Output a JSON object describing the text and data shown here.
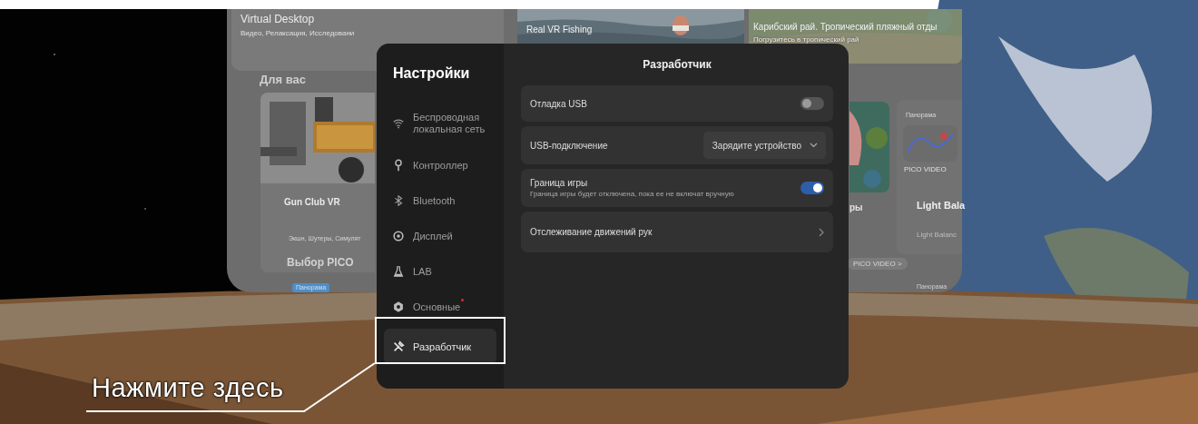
{
  "store": {
    "banners": [
      {
        "title": "Virtual Desktop",
        "subtitle": "Видео, Релаксация, Исследовани"
      },
      {
        "title": "Real VR Fishing"
      },
      {
        "title": "Карибский рай. Тропический пляжный отды",
        "subtitle": "Погрузитесь в тропический рай"
      }
    ],
    "section_for_you": "Для вас",
    "game_card": {
      "title": "Gun Club VR",
      "tags": "Экшн, Шутеры, Симулят"
    },
    "section_pico": "Выбор PICO",
    "tag_bottom_left": "Панорама",
    "coral_card_title": "ры",
    "panorama_card": {
      "tag": "Панорама",
      "brand": "PICO VIDEO",
      "title": "Light Bala",
      "subtitle": "Light Balanc"
    },
    "pico_video_link": "PICO VIDEO >",
    "tag_bottom_right": "Панорама"
  },
  "settings": {
    "title": "Настройки",
    "menu": [
      {
        "label": "Беспроводная локальная сеть",
        "selected": false,
        "notification": false
      },
      {
        "label": "Контроллер",
        "selected": false,
        "notification": false
      },
      {
        "label": "Bluetooth",
        "selected": false,
        "notification": false
      },
      {
        "label": "Дисплей",
        "selected": false,
        "notification": false
      },
      {
        "label": "LAB",
        "selected": false,
        "notification": false
      },
      {
        "label": "Основные",
        "selected": false,
        "notification": true
      },
      {
        "label": "Разработчик",
        "selected": true,
        "notification": false
      }
    ],
    "page_title": "Разработчик",
    "rows": [
      {
        "kind": "toggle",
        "label": "Отладка USB",
        "on": false
      },
      {
        "kind": "dropdown",
        "label": "USB-подключение",
        "value": "Зарядите устройство"
      },
      {
        "kind": "toggle",
        "label": "Граница игры",
        "description": "Граница игры будет отключена, пока ее не включат вручную",
        "on": true
      },
      {
        "kind": "link",
        "label": "Отслеживание движений рук"
      }
    ]
  },
  "callout": {
    "text": "Нажмите здесь"
  }
}
